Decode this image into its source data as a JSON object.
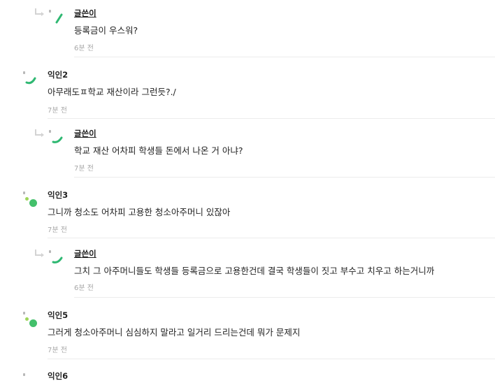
{
  "writer_label": "글쓴이",
  "comments": [
    {
      "author": "글쓴이",
      "text": "등록금이 우스워?",
      "time": "6분 전"
    },
    {
      "author": "익인2",
      "text": "아무래도ㅍ학교 재산이라 그런듯?./",
      "time": "7분 전"
    },
    {
      "author": "글쓴이",
      "text": "학교 재산 어차피 학생들 돈에서 나온 거 아냐?",
      "time": "7분 전"
    },
    {
      "author": "익인3",
      "text": "그니까 청소도 어차피 고용한 청소아주머니 있잖아",
      "time": "7분 전"
    },
    {
      "author": "글쓴이",
      "text": "그치 그 아주머니들도 학생들 등록금으로 고용한건데 결국 학생들이 짓고 부수고 치우고 하는거니까",
      "time": "6분 전"
    },
    {
      "author": "익인5",
      "text": "그러게 청소아주머니 심심하지 말라고 일거리 드리는건데 뭐가 문제지",
      "time": "7분 전"
    },
    {
      "author": "익인6",
      "text": "",
      "time": ""
    }
  ],
  "colors": {
    "accent_green": "#2fb872",
    "dot_green": "#43c06b",
    "dot_lime": "#9ed65a"
  }
}
